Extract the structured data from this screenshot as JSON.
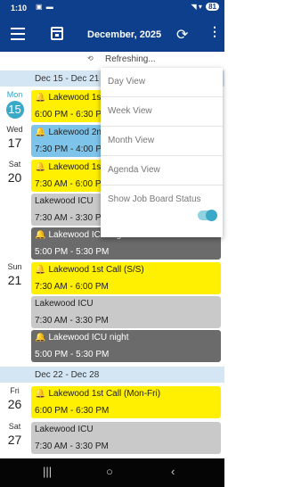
{
  "status": {
    "time": "1:10",
    "battery": "81"
  },
  "appbar": {
    "title": "December, 2025"
  },
  "refresh": {
    "text": "Refreshing..."
  },
  "menu": {
    "items": [
      "Day View",
      "Week View",
      "Month View",
      "Agenda View",
      "Show Job Board Status"
    ],
    "job_board_toggle": "on"
  },
  "weeks": [
    "Dec 15 - Dec 21",
    "Dec 22 - Dec 28"
  ],
  "days": [
    {
      "dow": "Mon",
      "num": "15"
    },
    {
      "dow": "Wed",
      "num": "17"
    },
    {
      "dow": "Sat",
      "num": "20"
    },
    {
      "dow": "Sun",
      "num": "21"
    },
    {
      "dow": "Fri",
      "num": "26"
    },
    {
      "dow": "Sat",
      "num": "27"
    }
  ],
  "events": [
    {
      "title": "Lakewood 1st",
      "time": "6:00 PM - 6:30 PM",
      "alert": true
    },
    {
      "title": "Lakewood 2nd",
      "time": "7:30 PM - 4:00 PM",
      "alert": true
    },
    {
      "title": "Lakewood 1st",
      "time": "7:30 AM - 6:00 PM",
      "alert": true
    },
    {
      "title": "Lakewood ICU",
      "time": "7:30 AM - 3:30 PM",
      "alert": false
    },
    {
      "title": "Lakewood ICU night",
      "time": "5:00 PM - 5:30 PM",
      "alert": true
    },
    {
      "title": "Lakewood 1st Call (S/S)",
      "time": "7:30 AM - 6:00 PM",
      "alert": true
    },
    {
      "title": "Lakewood ICU",
      "time": "7:30 AM - 3:30 PM",
      "alert": false
    },
    {
      "title": "Lakewood ICU night",
      "time": "5:00 PM - 5:30 PM",
      "alert": true
    },
    {
      "title": "Lakewood 1st Call (Mon-Fri)",
      "time": "6:00 PM - 6:30 PM",
      "alert": true
    },
    {
      "title": "Lakewood ICU",
      "time": "7:30 AM - 3:30 PM",
      "alert": false
    }
  ],
  "icons": {
    "menu": "hamburger-icon",
    "calendar": "calendar-icon",
    "refresh": "refresh-icon",
    "more": "more-vert-icon",
    "alert": "bell-icon"
  },
  "colors": {
    "primary": "#0d3f8c",
    "yellow_event": "#ffef00",
    "grey_event": "#c9c9c9",
    "dark_event": "#6b6b6b",
    "blue_event": "#7ec4ea",
    "today": "#3aa9c8"
  }
}
